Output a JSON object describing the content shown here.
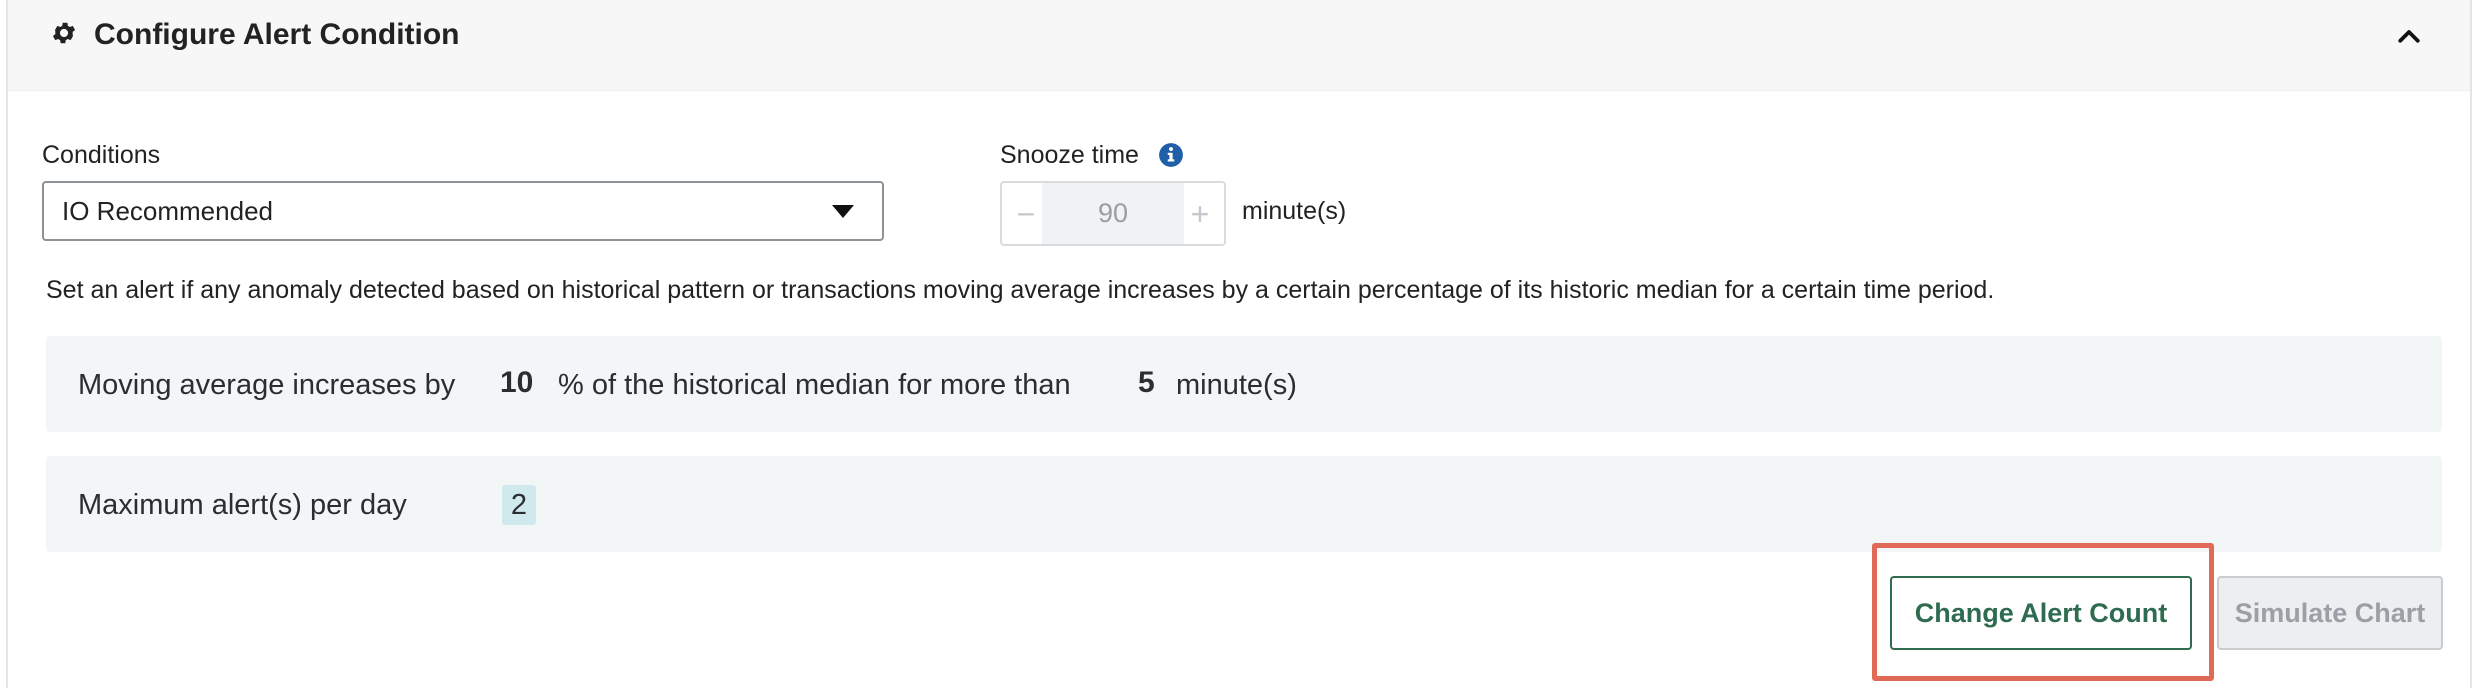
{
  "header": {
    "title": "Configure Alert Condition"
  },
  "conditions": {
    "label": "Conditions",
    "selected": "IO Recommended"
  },
  "snooze": {
    "label": "Snooze time",
    "minus": "−",
    "plus": "+",
    "value": "90",
    "unit": "minute(s)"
  },
  "description": "Set an alert if any anomaly detected based on historical pattern or transactions moving average increases by a certain percentage of its historic median for a certain time period.",
  "rule": {
    "prefix": "Moving average increases by",
    "percent_value": "10",
    "middle": "% of the historical median for more than",
    "minutes_value": "5",
    "suffix": "minute(s)"
  },
  "max_alerts": {
    "label": "Maximum alert(s) per day",
    "value": "2"
  },
  "actions": {
    "change_alert_count": "Change Alert Count",
    "simulate_chart": "Simulate Chart"
  },
  "colors": {
    "primary": "#2e6b4f",
    "highlight": "#e06a55",
    "info": "#1f5fa8"
  },
  "icons": {
    "header": "gear-icon",
    "collapse": "chevron-up-icon",
    "snooze_info": "info-icon",
    "dropdown": "chevron-down-icon"
  }
}
